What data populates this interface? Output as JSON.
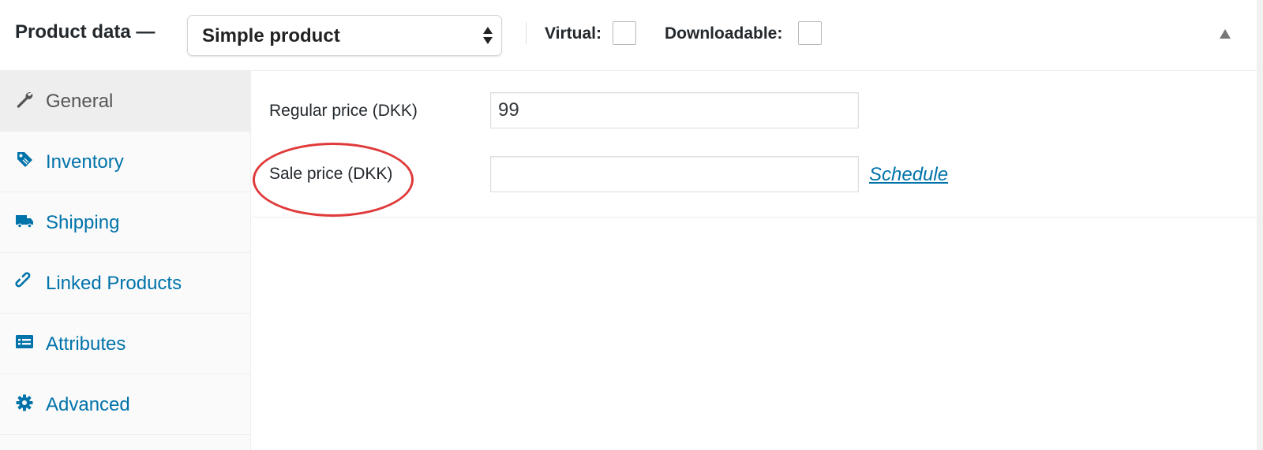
{
  "header": {
    "title": "Product data —",
    "product_type": "Simple product",
    "virtual_label": "Virtual:",
    "downloadable_label": "Downloadable:"
  },
  "tabs": [
    {
      "label": "General",
      "icon": "wrench-icon",
      "active": true
    },
    {
      "label": "Inventory",
      "icon": "tag-icon",
      "active": false
    },
    {
      "label": "Shipping",
      "icon": "truck-icon",
      "active": false
    },
    {
      "label": "Linked Products",
      "icon": "link-icon",
      "active": false
    },
    {
      "label": "Attributes",
      "icon": "list-icon",
      "active": false
    },
    {
      "label": "Advanced",
      "icon": "gear-icon",
      "active": false
    }
  ],
  "general": {
    "regular_price_label": "Regular price (DKK)",
    "regular_price_value": "99",
    "sale_price_label": "Sale price (DKK)",
    "sale_price_value": "",
    "schedule_link": "Schedule"
  },
  "colors": {
    "link": "#0073aa",
    "highlight": "#e03a3a",
    "active_tab_bg": "#eeeeee"
  }
}
